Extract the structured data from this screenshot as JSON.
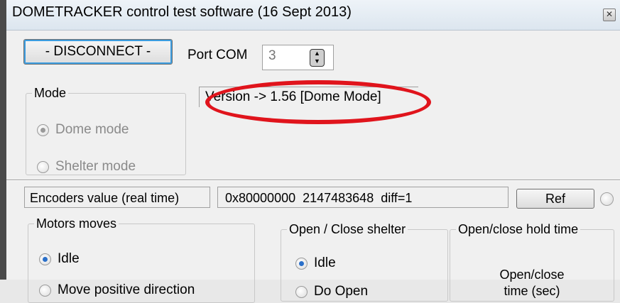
{
  "window": {
    "title": "DOMETRACKER control test software (16 Sept 2013)",
    "close_glyph": "✕"
  },
  "connection": {
    "button_label": "- DISCONNECT -",
    "port_label": "Port COM",
    "port_value": "3"
  },
  "mode": {
    "legend": "Mode",
    "options": [
      {
        "label": "Dome mode",
        "selected": true
      },
      {
        "label": "Shelter mode",
        "selected": false
      }
    ]
  },
  "version_text": "Version -> 1.56 [Dome Mode]",
  "annotation": {
    "color": "#e0141c"
  },
  "encoders": {
    "label": "Encoders value (real time)",
    "value": "0x80000000  2147483648  diff=1",
    "ref_label": "Ref"
  },
  "motors": {
    "legend": "Motors moves",
    "options": [
      {
        "label": "Idle",
        "selected": true
      },
      {
        "label": "Move  positive direction",
        "selected": false
      }
    ]
  },
  "shelter": {
    "legend": "Open / Close shelter",
    "options": [
      {
        "label": "Idle",
        "selected": true
      },
      {
        "label": "Do Open",
        "selected": false
      }
    ]
  },
  "hold": {
    "legend": "Open/close hold time",
    "line1": "Open/close",
    "line2": "time (sec)"
  }
}
